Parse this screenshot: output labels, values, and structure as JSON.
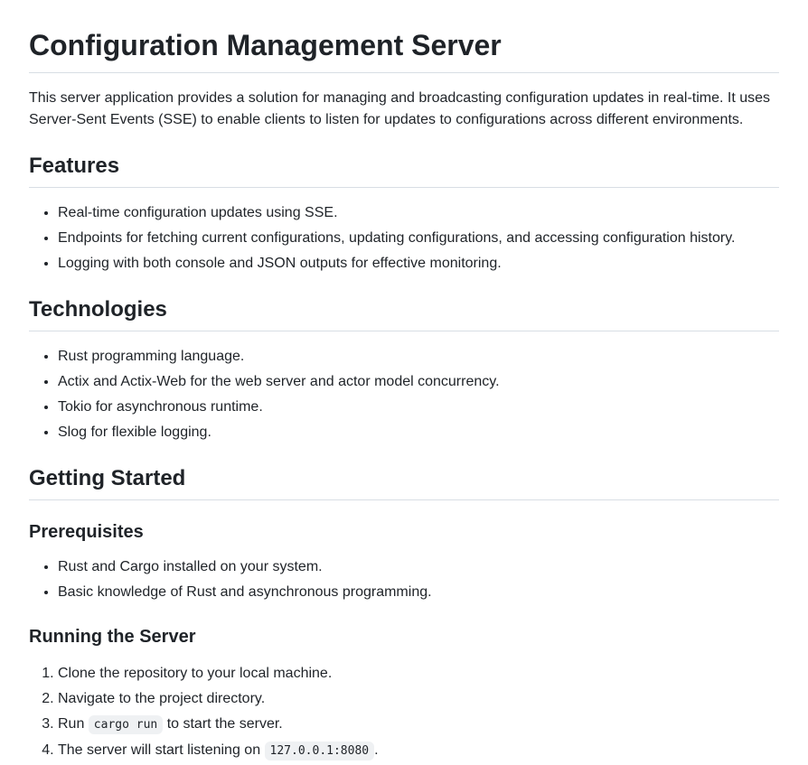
{
  "title": "Configuration Management Server",
  "intro": "This server application provides a solution for managing and broadcasting configuration updates in real-time. It uses Server-Sent Events (SSE) to enable clients to listen for updates to configurations across different environments.",
  "features": {
    "heading": "Features",
    "items": [
      "Real-time configuration updates using SSE.",
      "Endpoints for fetching current configurations, updating configurations, and accessing configuration history.",
      "Logging with both console and JSON outputs for effective monitoring."
    ]
  },
  "technologies": {
    "heading": "Technologies",
    "items": [
      "Rust programming language.",
      "Actix and Actix-Web for the web server and actor model concurrency.",
      "Tokio for asynchronous runtime.",
      "Slog for flexible logging."
    ]
  },
  "getting_started": {
    "heading": "Getting Started",
    "prerequisites": {
      "heading": "Prerequisites",
      "items": [
        "Rust and Cargo installed on your system.",
        "Basic knowledge of Rust and asynchronous programming."
      ]
    },
    "running": {
      "heading": "Running the Server",
      "step1": "Clone the repository to your local machine.",
      "step2": "Navigate to the project directory.",
      "step3_before": "Run ",
      "step3_code": "cargo run",
      "step3_after": " to start the server.",
      "step4_before": "The server will start listening on ",
      "step4_code": "127.0.0.1:8080",
      "step4_after": "."
    }
  }
}
